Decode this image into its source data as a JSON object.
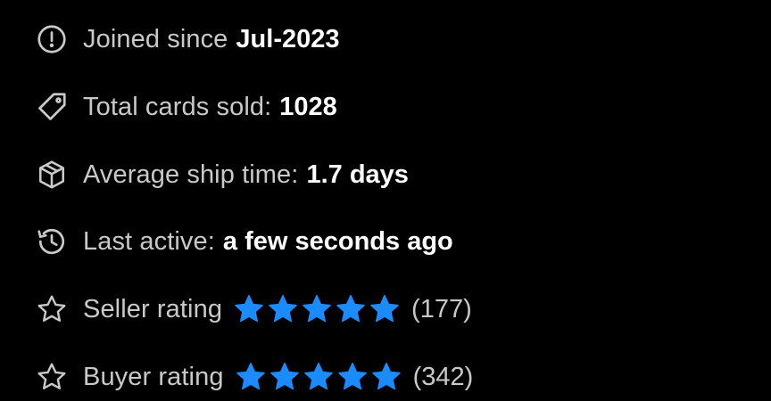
{
  "colors": {
    "background": "#000000",
    "label": "#c9c9c9",
    "value": "#ffffff",
    "star": "#1a8cff",
    "icon": "#c9c9c9"
  },
  "profile": {
    "joined": {
      "icon": "info-circle-icon",
      "label": "Joined since",
      "value": "Jul-2023"
    },
    "cards_sold": {
      "icon": "tag-icon",
      "label": "Total cards sold:",
      "value": "1028"
    },
    "ship_time": {
      "icon": "box-icon",
      "label": "Average ship time:",
      "value": "1.7 days"
    },
    "last_active": {
      "icon": "history-icon",
      "label": "Last active:",
      "value": "a few seconds ago"
    },
    "seller_rating": {
      "icon": "star-outline-icon",
      "label": "Seller rating",
      "stars": 5,
      "max_stars": 5,
      "count": "(177)"
    },
    "buyer_rating": {
      "icon": "star-outline-icon",
      "label": "Buyer rating",
      "stars": 5,
      "max_stars": 5,
      "count": "(342)"
    }
  }
}
